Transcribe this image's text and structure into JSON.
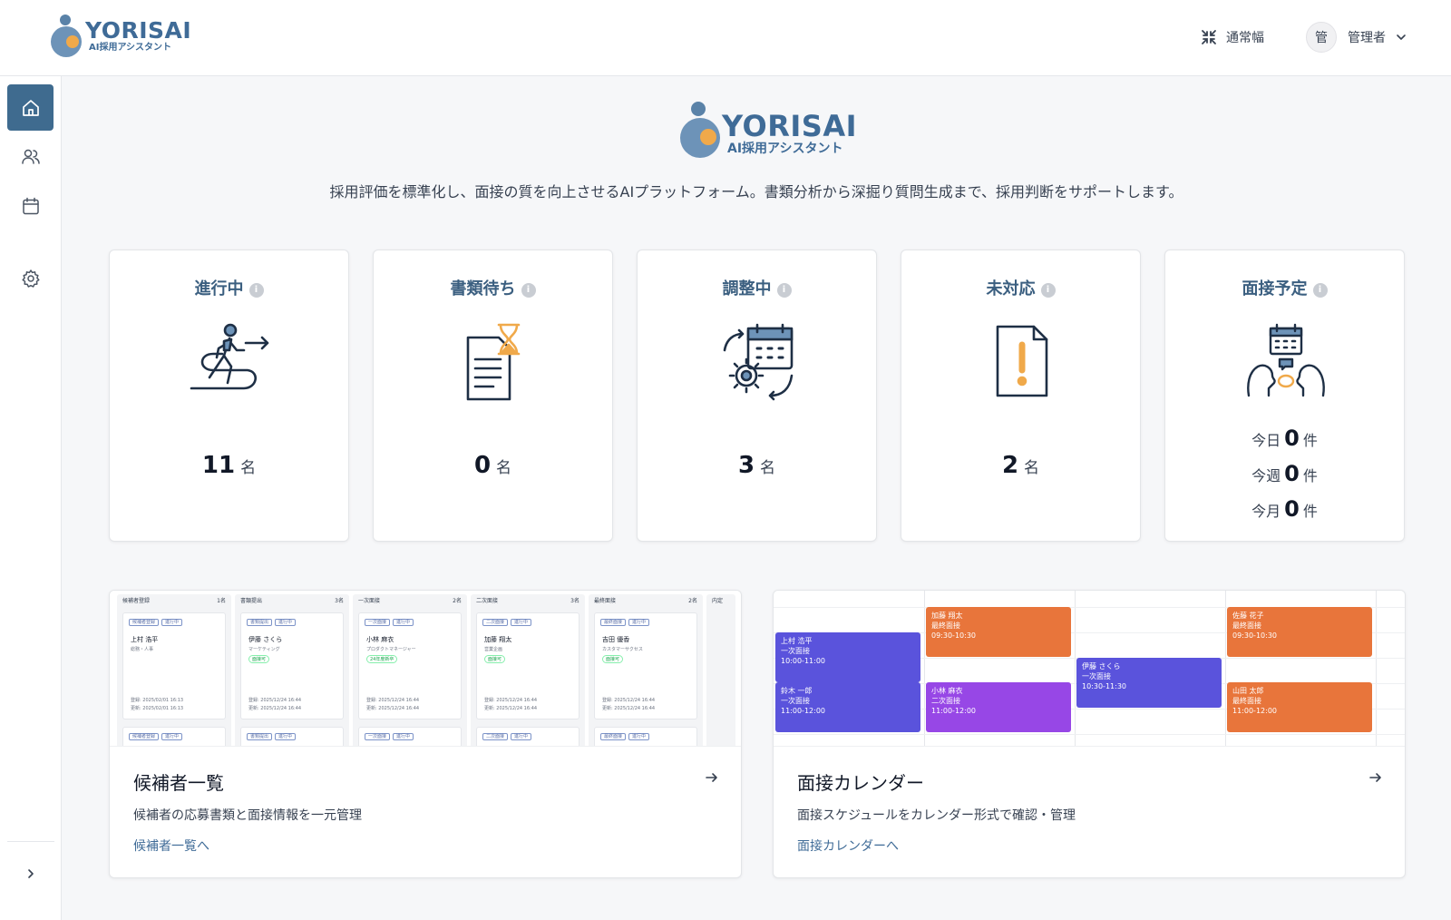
{
  "brand": {
    "name": "YORISAI",
    "subtitle": "AI採用アシスタント"
  },
  "header": {
    "width_toggle_label": "通常幅",
    "user": {
      "avatar_initial": "管",
      "name": "管理者"
    }
  },
  "sidebar": {
    "items": [
      {
        "name": "home",
        "icon": "home-icon",
        "active": true
      },
      {
        "name": "candidates",
        "icon": "users-icon",
        "active": false
      },
      {
        "name": "calendar",
        "icon": "calendar-icon",
        "active": false
      },
      {
        "name": "settings",
        "icon": "gear-icon",
        "active": false
      }
    ],
    "expand_icon": "chevron-right-icon"
  },
  "hero": {
    "tagline": "採用評価を標準化し、面接の質を向上させるAIプラットフォーム。書類分析から深掘り質問生成まで、採用判断をサポートします。"
  },
  "stats": [
    {
      "title": "進行中",
      "value": "11",
      "unit": "名",
      "icon": "walking-person-icon"
    },
    {
      "title": "書類待ち",
      "value": "0",
      "unit": "名",
      "icon": "document-hourglass-icon"
    },
    {
      "title": "調整中",
      "value": "3",
      "unit": "名",
      "icon": "calendar-gear-icon"
    },
    {
      "title": "未対応",
      "value": "2",
      "unit": "名",
      "icon": "document-alert-icon"
    },
    {
      "title": "面接予定",
      "icon": "interview-icon",
      "schedule": [
        {
          "label": "今日",
          "value": "0",
          "unit": "件"
        },
        {
          "label": "今週",
          "value": "0",
          "unit": "件"
        },
        {
          "label": "今月",
          "value": "0",
          "unit": "件"
        }
      ]
    }
  ],
  "features": [
    {
      "title": "候補者一覧",
      "description": "候補者の応募書類と面接情報を一元管理",
      "link": "候補者一覧へ",
      "preview": {
        "columns": [
          {
            "title": "候補者登録",
            "count": "1名",
            "card": {
              "tags": [
                "候補者登録",
                "進行中"
              ],
              "name": "上村 浩平",
              "sub": "総務・人事",
              "d1": "登録: 2025/02/01 16:13",
              "d2": "更新: 2025/02/01 16:13"
            }
          },
          {
            "title": "書類提出",
            "count": "3名",
            "card": {
              "tags": [
                "書類提出",
                "進行中"
              ],
              "name": "伊藤 さくら",
              "sub": "マーケティング",
              "badge": "面接可",
              "d1": "登録: 2025/12/24 16:44",
              "d2": "更新: 2025/12/24 16:44"
            }
          },
          {
            "title": "一次面接",
            "count": "2名",
            "card": {
              "tags": [
                "一次面接",
                "進行中"
              ],
              "name": "小林 麻衣",
              "sub": "プロダクトマネージャー",
              "badge": "24年度新卒",
              "d1": "登録: 2025/12/24 16:44",
              "d2": "更新: 2025/12/24 16:44"
            }
          },
          {
            "title": "二次面接",
            "count": "3名",
            "card": {
              "tags": [
                "二次面接",
                "進行中"
              ],
              "name": "加藤 翔太",
              "sub": "営業企画",
              "badge": "面接可",
              "d1": "登録: 2025/12/24 16:44",
              "d2": "更新: 2025/12/24 16:44"
            }
          },
          {
            "title": "最終面接",
            "count": "2名",
            "card": {
              "tags": [
                "最終面接",
                "進行中"
              ],
              "name": "吉田 優香",
              "sub": "カスタマーサクセス",
              "badge": "面接可",
              "d1": "登録: 2025/12/24 16:44",
              "d2": "更新: 2025/12/24 16:44"
            }
          },
          {
            "title": "内定",
            "count": "",
            "card": null
          }
        ]
      }
    },
    {
      "title": "面接カレンダー",
      "description": "面接スケジュールをカレンダー形式で確認・管理",
      "link": "面接カレンダーへ",
      "preview": {
        "events": [
          {
            "name": "上村 浩平",
            "stage": "一次面接",
            "time": "10:00-11:00",
            "color": "indigo"
          },
          {
            "name": "鈴木 一郎",
            "stage": "一次面接",
            "time": "11:00-12:00",
            "color": "indigo"
          },
          {
            "name": "加藤 翔太",
            "stage": "最終面接",
            "time": "09:30-10:30",
            "color": "orange"
          },
          {
            "name": "小林 麻衣",
            "stage": "二次面接",
            "time": "11:00-12:00",
            "color": "violet"
          },
          {
            "name": "伊藤 さくら",
            "stage": "一次面接",
            "time": "10:30-11:30",
            "color": "indigo"
          },
          {
            "name": "佐藤 花子",
            "stage": "最終面接",
            "time": "09:30-10:30",
            "color": "orange"
          },
          {
            "name": "山田 太郎",
            "stage": "最終面接",
            "time": "11:00-12:00",
            "color": "orange"
          }
        ]
      }
    }
  ],
  "colors": {
    "brand": "#3f6b97",
    "sidebar_active": "#3f6b8f",
    "accent_orange": "#f0a94a"
  }
}
